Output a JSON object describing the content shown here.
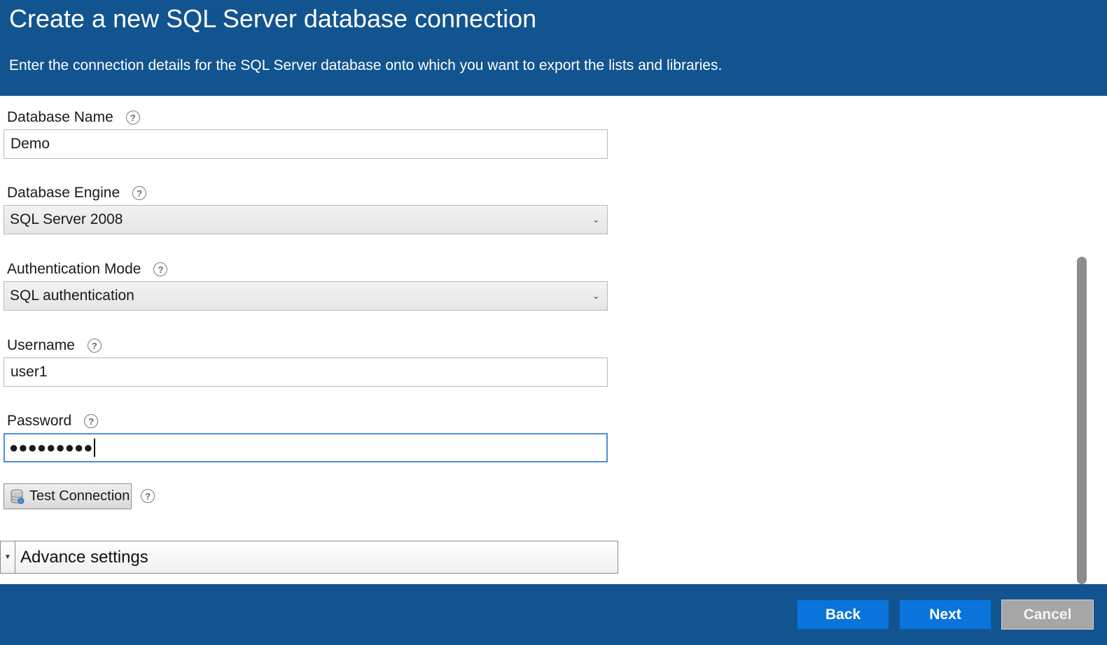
{
  "header": {
    "title": "Create a new SQL Server database connection",
    "subtitle": "Enter the connection details for the SQL Server database onto which you want to export the lists and libraries."
  },
  "form": {
    "database_name": {
      "label": "Database Name",
      "value": "Demo"
    },
    "database_engine": {
      "label": "Database Engine",
      "selected": "SQL Server 2008"
    },
    "auth_mode": {
      "label": "Authentication Mode",
      "selected": "SQL authentication"
    },
    "username": {
      "label": "Username",
      "value": "user1"
    },
    "password": {
      "label": "Password",
      "masked_value": "●●●●●●●●●"
    },
    "test_connection_label": "Test Connection"
  },
  "advance_settings": {
    "label": "Advance settings"
  },
  "footer": {
    "back_label": "Back",
    "next_label": "Next",
    "cancel_label": "Cancel"
  },
  "icons": {
    "help": "question-circle-icon",
    "dropdown": "chevron-down-icon",
    "database": "database-icon",
    "expand": "triangle-down-icon"
  },
  "colors": {
    "header_bg": "#12548f",
    "button_blue": "#0a74da",
    "button_disabled": "#a6a6a6",
    "focus_border": "#4a90d9"
  }
}
